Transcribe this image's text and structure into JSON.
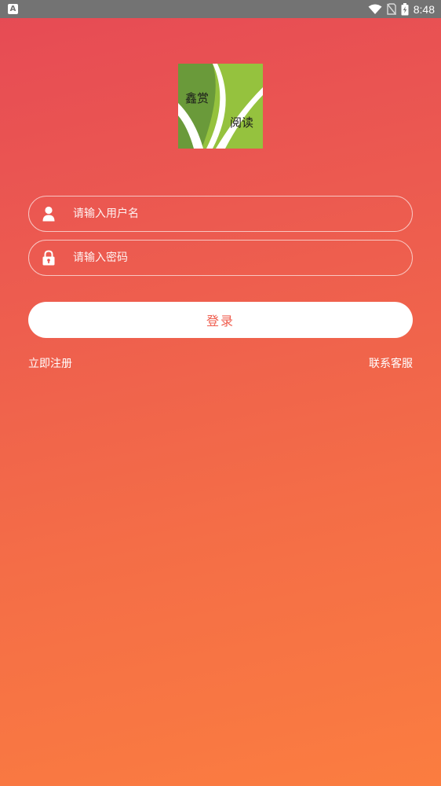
{
  "status_bar": {
    "left_icon": "A",
    "time": "8:48",
    "icons": [
      "wifi-icon",
      "no-sim-icon",
      "battery-charging-icon"
    ]
  },
  "logo": {
    "line1": "鑫赏",
    "line2": "阅读",
    "colors": {
      "dark_green": "#6a9a3a",
      "light_green": "#95c23e",
      "stripe": "#ffffff"
    }
  },
  "form": {
    "username_placeholder": "请输入用户名",
    "password_placeholder": "请输入密码",
    "login_label": "登录"
  },
  "links": {
    "register": "立即注册",
    "customer_service": "联系客服"
  },
  "colors": {
    "gradient_top": "#e64a55",
    "gradient_bottom": "#fb7d40",
    "button_text": "#ef5d4e"
  }
}
